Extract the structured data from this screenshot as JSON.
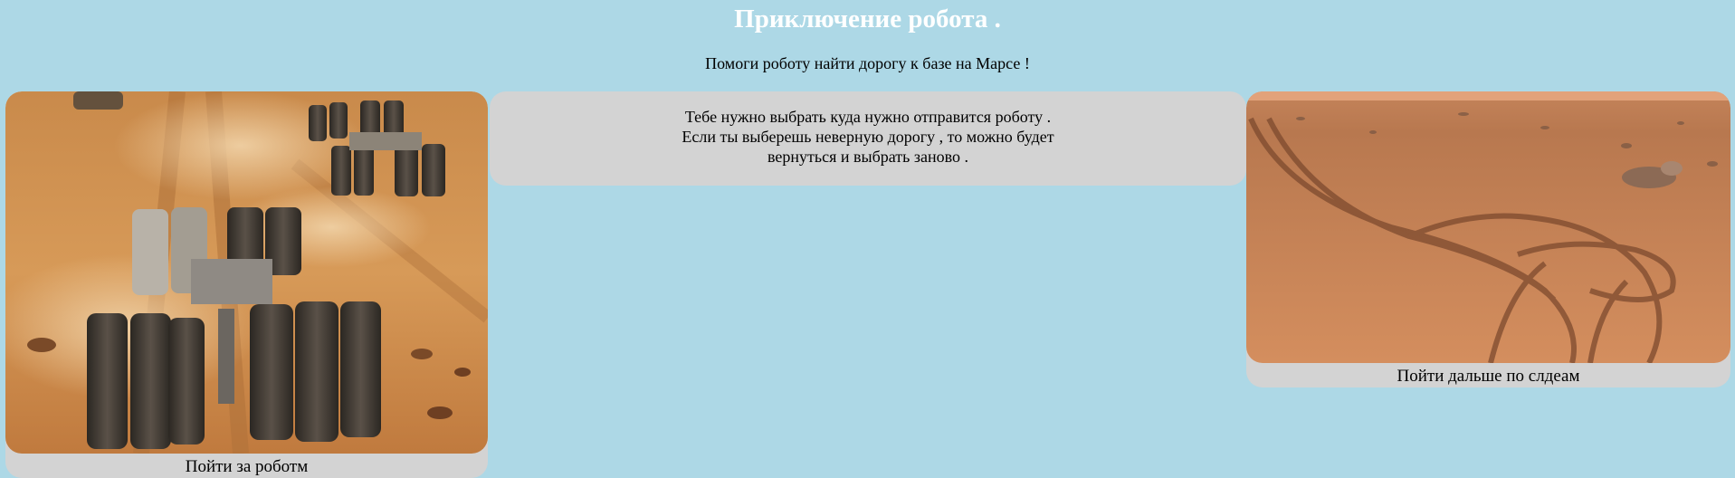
{
  "header": {
    "title": "Приключение робота .",
    "subtitle": "Помоги роботу найти дорогу к базе на Марсе !"
  },
  "intro": {
    "lines": [
      "Тебе нужно выбрать куда нужно отправится роботу .",
      "Если ты выберешь неверную дорогу , то можно будет",
      "вернуться и выбрать заново ."
    ]
  },
  "choices": {
    "left": {
      "caption": "Пойти за роботм",
      "image_alt": "rover-convoy-image"
    },
    "right": {
      "caption": "Пойти дальше по слдеам",
      "image_alt": "rover-tracks-image"
    }
  },
  "colors": {
    "background": "#add8e6",
    "card": "#d3d3d3",
    "title": "#ffffff"
  }
}
